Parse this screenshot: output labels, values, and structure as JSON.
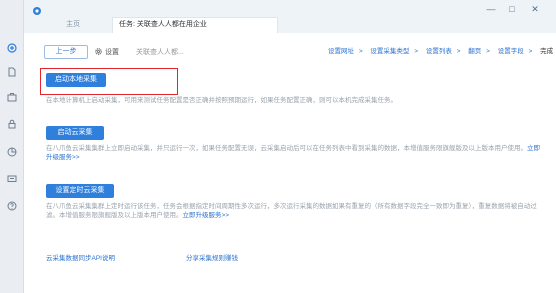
{
  "tabs": {
    "home": "主页",
    "active": "任务: 关联查人人都在用企业"
  },
  "window": {
    "minimize": "—",
    "maximize": "□",
    "close": "✕"
  },
  "toolbar": {
    "back_label": "上一步",
    "settings_label": "设置",
    "task_name": "关联查人人都..."
  },
  "steps": [
    {
      "label": "设置网址",
      "sep": ">"
    },
    {
      "label": "设置采集类型",
      "sep": ">"
    },
    {
      "label": "设置列表",
      "sep": ">"
    },
    {
      "label": "翻页",
      "sep": ">"
    },
    {
      "label": "设置字段",
      "sep": ">"
    },
    {
      "label": "完成",
      "sep": ""
    }
  ],
  "options": {
    "local": {
      "button": "启动本地采集",
      "desc": "在本地计算机上启动采集，可用来测试任务配置是否正确并按照预期运行，如果任务配置正确，则可以本机完成采集任务。"
    },
    "cloud": {
      "button": "启动云采集",
      "desc": "在八爪鱼云采集集群上立即启动采集，并只运行一次，如果任务配置无误，云采集启动后可以在任务列表中看到采集的数据，本增值服务限旗舰版及以上版本用户使用。",
      "link": "立即升级服务>>"
    },
    "timer": {
      "button": "设置定时云采集",
      "desc": "在八爪鱼云采集集群上定时运行该任务，任务会根据指定时间周期性多次运行，多次运行采集的数据如果有重复的（所有数据字段完全一致即为重复），重复数据将被自动过滤。本增值服务限旗舰版及以上版本用户使用。",
      "link": "立即升级服务>>"
    }
  },
  "bottom_links": {
    "api": "云采集数据同步API说明",
    "share": "分享采集规则赚钱"
  },
  "colors": {
    "accent": "#2f7fdd",
    "highlight": "#e2262b",
    "link": "#2c73cf"
  },
  "sidebar_icons": [
    "plus-circle-icon",
    "document-icon",
    "briefcase-icon",
    "lock-icon",
    "pie-chart-icon",
    "message-icon",
    "help-icon"
  ]
}
